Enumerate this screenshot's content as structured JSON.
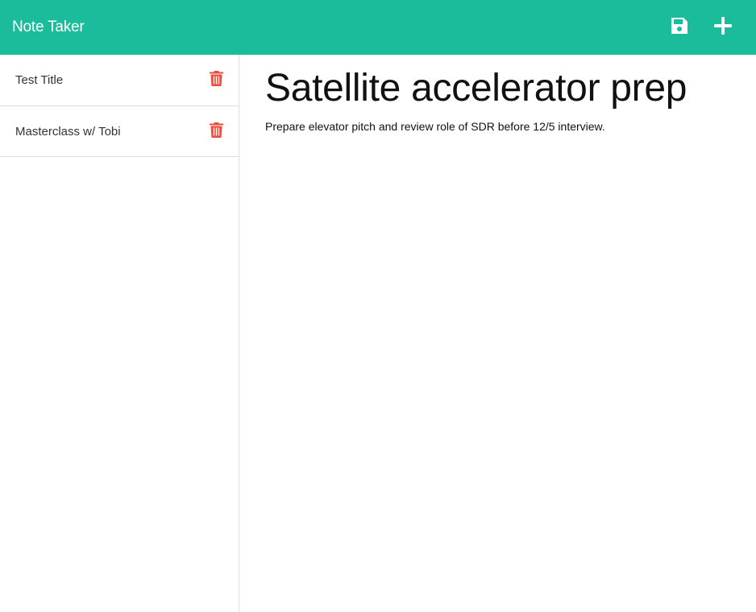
{
  "header": {
    "brand": "Note Taker",
    "save_icon": "save-icon",
    "new_icon": "plus-icon",
    "color": "#1abc9c"
  },
  "sidebar": {
    "items": [
      {
        "title": "Test Title",
        "icon": "trash-icon"
      },
      {
        "title": "Masterclass w/ Tobi",
        "icon": "trash-icon"
      }
    ],
    "delete_color": "#e74c3c"
  },
  "note": {
    "title": "Satellite accelerator prep",
    "text": "Prepare elevator pitch and review role of SDR before 12/5 interview."
  }
}
